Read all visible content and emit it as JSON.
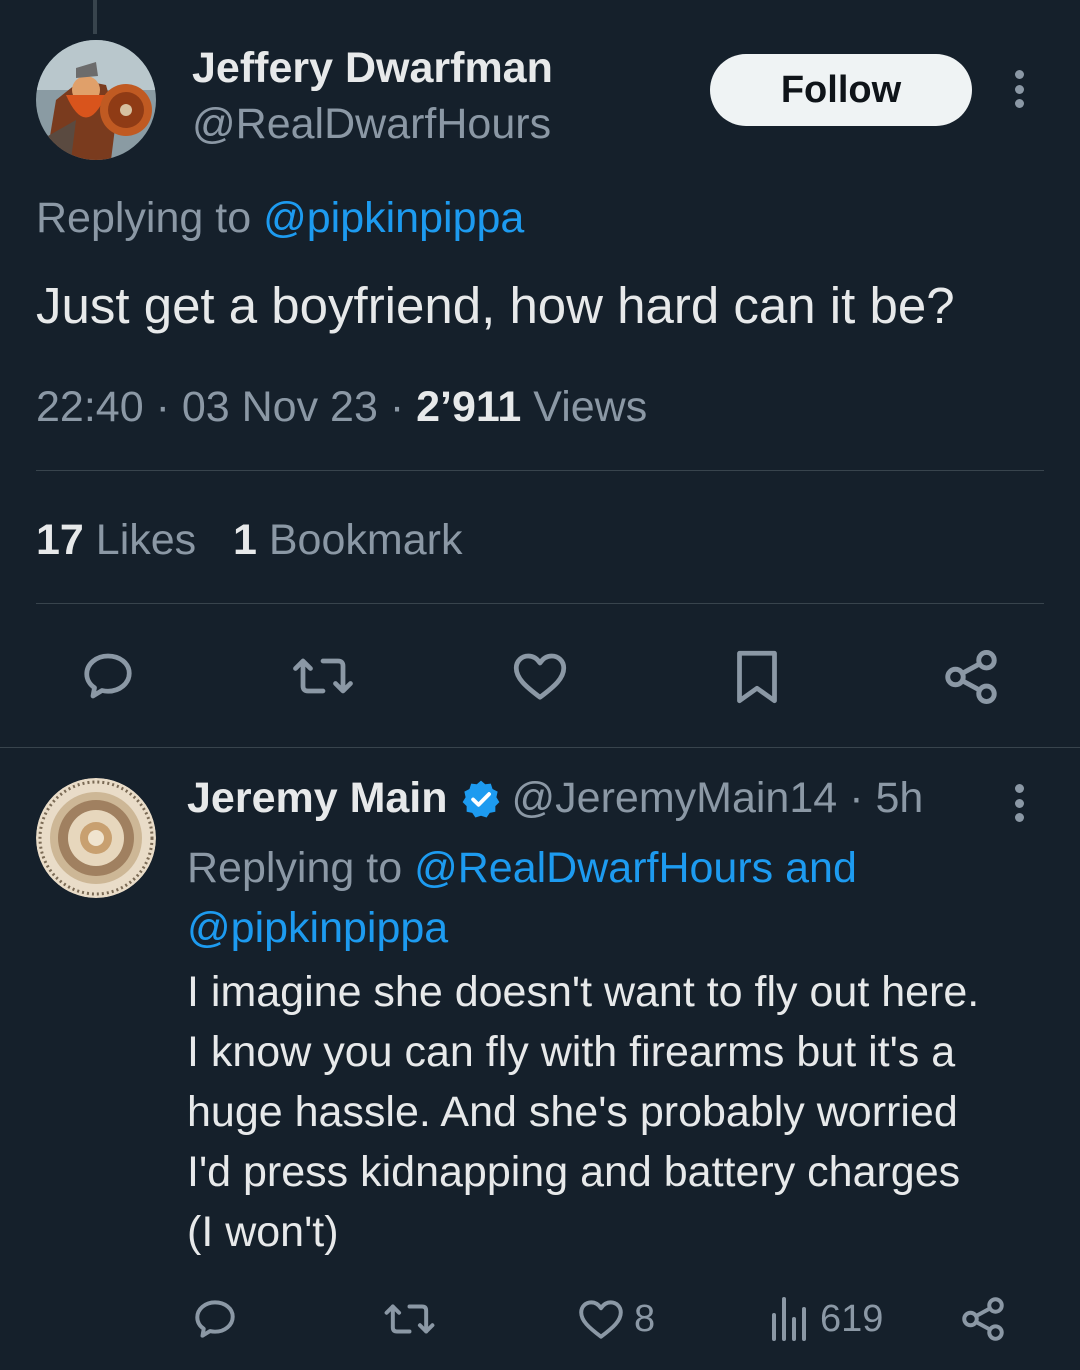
{
  "tweet": {
    "author_name": "Jeffery Dwarfman",
    "author_handle": "@RealDwarfHours",
    "follow_label": "Follow",
    "replying_prefix": "Replying to",
    "replying_to": "@pipkinpippa",
    "text": "Just get a boyfriend, how hard can it be?",
    "time": "22:40",
    "date": "03 Nov 23",
    "separator": "·",
    "views_count": "2’911",
    "views_label": "Views",
    "likes_count": "17",
    "likes_label": "Likes",
    "bookmarks_count": "1",
    "bookmarks_label": "Bookmark"
  },
  "reply": {
    "author_name": "Jeremy Main",
    "author_handle": "@JeremyMain14",
    "time_ago": "5h",
    "separator": "·",
    "replying_prefix": "Replying to",
    "replying_to_line1": "@RealDwarfHours and",
    "replying_to_line2": "@pipkinpippa",
    "text_lines": [
      "I imagine she doesn't want to fly out here.",
      "I know you can fly with firearms but it's a",
      "huge hassle. And she's probably worried",
      "I'd press kidnapping and battery charges",
      "(I won't)"
    ],
    "likes": "8",
    "views": "619"
  },
  "icons": {
    "reply": "reply-icon",
    "retweet": "retweet-icon",
    "like": "heart-icon",
    "bookmark": "bookmark-icon",
    "share": "share-icon",
    "views": "analytics-icon",
    "verified": "verified-badge-icon",
    "more": "more-vertical-icon"
  },
  "colors": {
    "background": "#15202b",
    "text": "#e7e9ea",
    "muted": "#8b98a5",
    "link": "#1d9bf0",
    "divider": "#38444d",
    "follow_bg": "#eff3f4"
  }
}
